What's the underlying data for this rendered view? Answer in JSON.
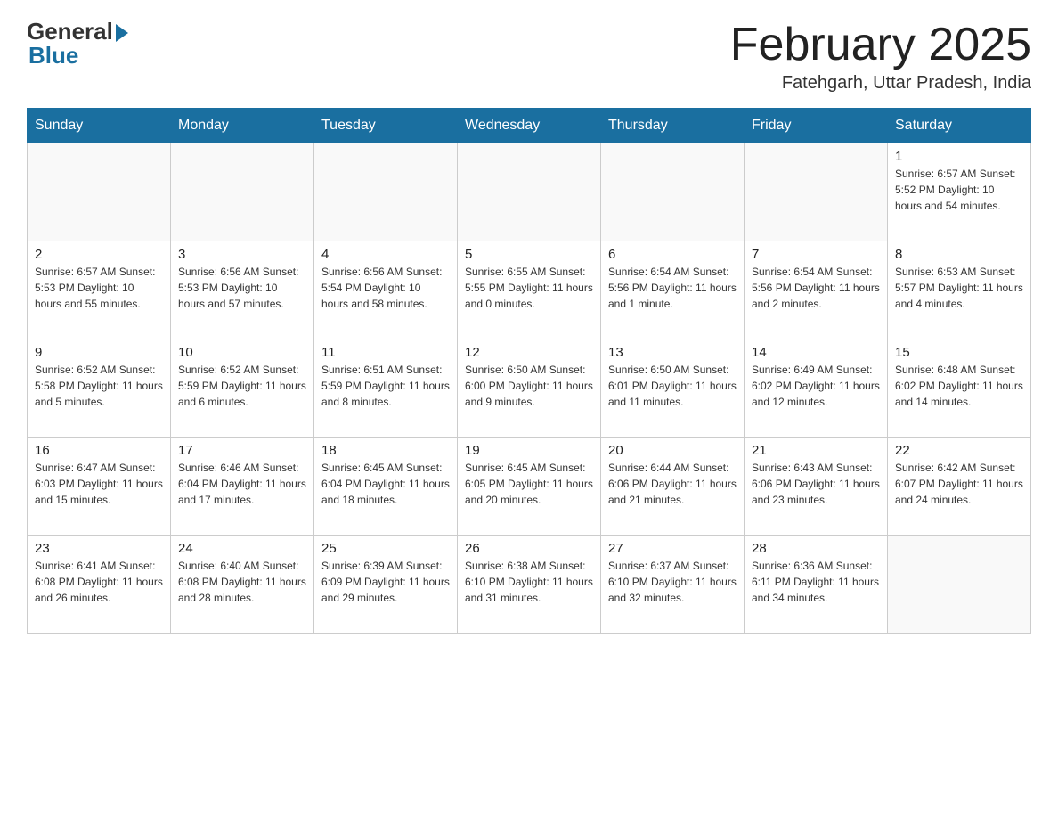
{
  "logo": {
    "general": "General",
    "blue": "Blue"
  },
  "header": {
    "title": "February 2025",
    "location": "Fatehgarh, Uttar Pradesh, India"
  },
  "days_of_week": [
    "Sunday",
    "Monday",
    "Tuesday",
    "Wednesday",
    "Thursday",
    "Friday",
    "Saturday"
  ],
  "weeks": [
    [
      {
        "day": "",
        "info": ""
      },
      {
        "day": "",
        "info": ""
      },
      {
        "day": "",
        "info": ""
      },
      {
        "day": "",
        "info": ""
      },
      {
        "day": "",
        "info": ""
      },
      {
        "day": "",
        "info": ""
      },
      {
        "day": "1",
        "info": "Sunrise: 6:57 AM\nSunset: 5:52 PM\nDaylight: 10 hours and 54 minutes."
      }
    ],
    [
      {
        "day": "2",
        "info": "Sunrise: 6:57 AM\nSunset: 5:53 PM\nDaylight: 10 hours and 55 minutes."
      },
      {
        "day": "3",
        "info": "Sunrise: 6:56 AM\nSunset: 5:53 PM\nDaylight: 10 hours and 57 minutes."
      },
      {
        "day": "4",
        "info": "Sunrise: 6:56 AM\nSunset: 5:54 PM\nDaylight: 10 hours and 58 minutes."
      },
      {
        "day": "5",
        "info": "Sunrise: 6:55 AM\nSunset: 5:55 PM\nDaylight: 11 hours and 0 minutes."
      },
      {
        "day": "6",
        "info": "Sunrise: 6:54 AM\nSunset: 5:56 PM\nDaylight: 11 hours and 1 minute."
      },
      {
        "day": "7",
        "info": "Sunrise: 6:54 AM\nSunset: 5:56 PM\nDaylight: 11 hours and 2 minutes."
      },
      {
        "day": "8",
        "info": "Sunrise: 6:53 AM\nSunset: 5:57 PM\nDaylight: 11 hours and 4 minutes."
      }
    ],
    [
      {
        "day": "9",
        "info": "Sunrise: 6:52 AM\nSunset: 5:58 PM\nDaylight: 11 hours and 5 minutes."
      },
      {
        "day": "10",
        "info": "Sunrise: 6:52 AM\nSunset: 5:59 PM\nDaylight: 11 hours and 6 minutes."
      },
      {
        "day": "11",
        "info": "Sunrise: 6:51 AM\nSunset: 5:59 PM\nDaylight: 11 hours and 8 minutes."
      },
      {
        "day": "12",
        "info": "Sunrise: 6:50 AM\nSunset: 6:00 PM\nDaylight: 11 hours and 9 minutes."
      },
      {
        "day": "13",
        "info": "Sunrise: 6:50 AM\nSunset: 6:01 PM\nDaylight: 11 hours and 11 minutes."
      },
      {
        "day": "14",
        "info": "Sunrise: 6:49 AM\nSunset: 6:02 PM\nDaylight: 11 hours and 12 minutes."
      },
      {
        "day": "15",
        "info": "Sunrise: 6:48 AM\nSunset: 6:02 PM\nDaylight: 11 hours and 14 minutes."
      }
    ],
    [
      {
        "day": "16",
        "info": "Sunrise: 6:47 AM\nSunset: 6:03 PM\nDaylight: 11 hours and 15 minutes."
      },
      {
        "day": "17",
        "info": "Sunrise: 6:46 AM\nSunset: 6:04 PM\nDaylight: 11 hours and 17 minutes."
      },
      {
        "day": "18",
        "info": "Sunrise: 6:45 AM\nSunset: 6:04 PM\nDaylight: 11 hours and 18 minutes."
      },
      {
        "day": "19",
        "info": "Sunrise: 6:45 AM\nSunset: 6:05 PM\nDaylight: 11 hours and 20 minutes."
      },
      {
        "day": "20",
        "info": "Sunrise: 6:44 AM\nSunset: 6:06 PM\nDaylight: 11 hours and 21 minutes."
      },
      {
        "day": "21",
        "info": "Sunrise: 6:43 AM\nSunset: 6:06 PM\nDaylight: 11 hours and 23 minutes."
      },
      {
        "day": "22",
        "info": "Sunrise: 6:42 AM\nSunset: 6:07 PM\nDaylight: 11 hours and 24 minutes."
      }
    ],
    [
      {
        "day": "23",
        "info": "Sunrise: 6:41 AM\nSunset: 6:08 PM\nDaylight: 11 hours and 26 minutes."
      },
      {
        "day": "24",
        "info": "Sunrise: 6:40 AM\nSunset: 6:08 PM\nDaylight: 11 hours and 28 minutes."
      },
      {
        "day": "25",
        "info": "Sunrise: 6:39 AM\nSunset: 6:09 PM\nDaylight: 11 hours and 29 minutes."
      },
      {
        "day": "26",
        "info": "Sunrise: 6:38 AM\nSunset: 6:10 PM\nDaylight: 11 hours and 31 minutes."
      },
      {
        "day": "27",
        "info": "Sunrise: 6:37 AM\nSunset: 6:10 PM\nDaylight: 11 hours and 32 minutes."
      },
      {
        "day": "28",
        "info": "Sunrise: 6:36 AM\nSunset: 6:11 PM\nDaylight: 11 hours and 34 minutes."
      },
      {
        "day": "",
        "info": ""
      }
    ]
  ]
}
